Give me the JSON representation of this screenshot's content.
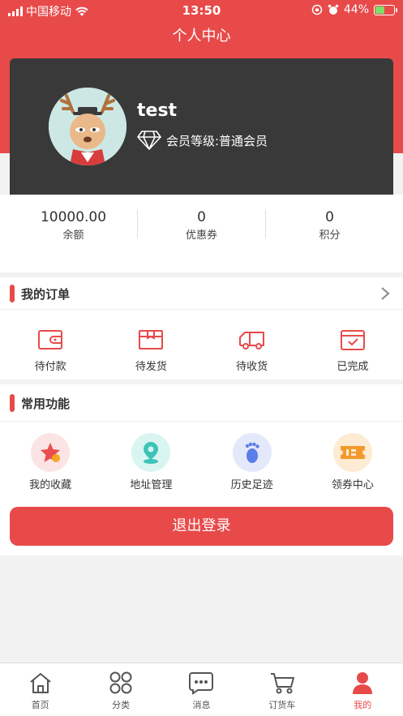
{
  "status_bar": {
    "carrier": "中国移动",
    "time": "13:50",
    "battery": "44%"
  },
  "header": {
    "title": "个人中心"
  },
  "profile": {
    "username": "test",
    "member_level": "会员等级:普通会员"
  },
  "stats": [
    {
      "value": "10000.00",
      "label": "余额"
    },
    {
      "value": "0",
      "label": "优惠券"
    },
    {
      "value": "0",
      "label": "积分"
    }
  ],
  "orders": {
    "title": "我的订单",
    "items": [
      {
        "label": "待付款",
        "icon": "wallet-icon"
      },
      {
        "label": "待发货",
        "icon": "package-icon"
      },
      {
        "label": "待收货",
        "icon": "truck-icon"
      },
      {
        "label": "已完成",
        "icon": "completed-icon"
      }
    ]
  },
  "functions": {
    "title": "常用功能",
    "items": [
      {
        "label": "我的收藏",
        "icon": "star-icon"
      },
      {
        "label": "地址管理",
        "icon": "location-icon"
      },
      {
        "label": "历史足迹",
        "icon": "footprint-icon"
      },
      {
        "label": "领券中心",
        "icon": "coupon-icon"
      }
    ]
  },
  "logout": {
    "label": "退出登录"
  },
  "tabbar": [
    {
      "label": "首页",
      "icon": "home-icon"
    },
    {
      "label": "分类",
      "icon": "category-icon"
    },
    {
      "label": "消息",
      "icon": "message-icon"
    },
    {
      "label": "订货车",
      "icon": "cart-icon"
    },
    {
      "label": "我的",
      "icon": "profile-icon",
      "active": true
    }
  ],
  "colors": {
    "accent": "#e84a4a",
    "card": "#393939"
  }
}
